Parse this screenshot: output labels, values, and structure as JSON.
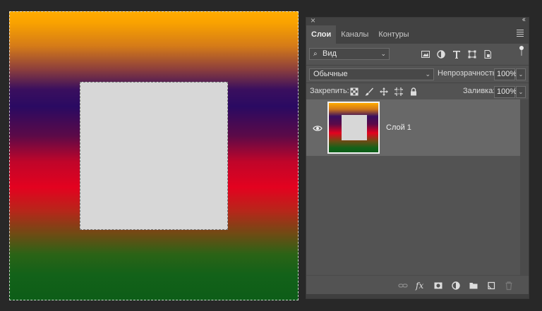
{
  "panel": {
    "tabs": [
      {
        "label": "Слои",
        "active": true
      },
      {
        "label": "Каналы",
        "active": false
      },
      {
        "label": "Контуры",
        "active": false
      }
    ],
    "filter": {
      "value": "Вид"
    },
    "blend_mode": {
      "value": "Обычные"
    },
    "opacity": {
      "label": "Непрозрачность:",
      "value": "100%"
    },
    "lock": {
      "label": "Закрепить:"
    },
    "fill": {
      "label": "Заливка:",
      "value": "100%"
    },
    "layers": [
      {
        "name": "Слой 1",
        "visible": true,
        "selected": true
      }
    ],
    "footer_icons": [
      "link-icon",
      "fx-icon",
      "mask-icon",
      "adjustment-icon",
      "folder-icon",
      "new-layer-icon",
      "trash-icon"
    ],
    "fx_label": "fx"
  },
  "colors": {
    "canvas_top": "#ffab00",
    "canvas_mid_purple": "#2a0a62",
    "canvas_red": "#e3021f",
    "canvas_bottom": "#0d5d18",
    "square": "#d7d7d7",
    "panel_bg": "#535353",
    "selected_layer_bg": "#686868"
  }
}
